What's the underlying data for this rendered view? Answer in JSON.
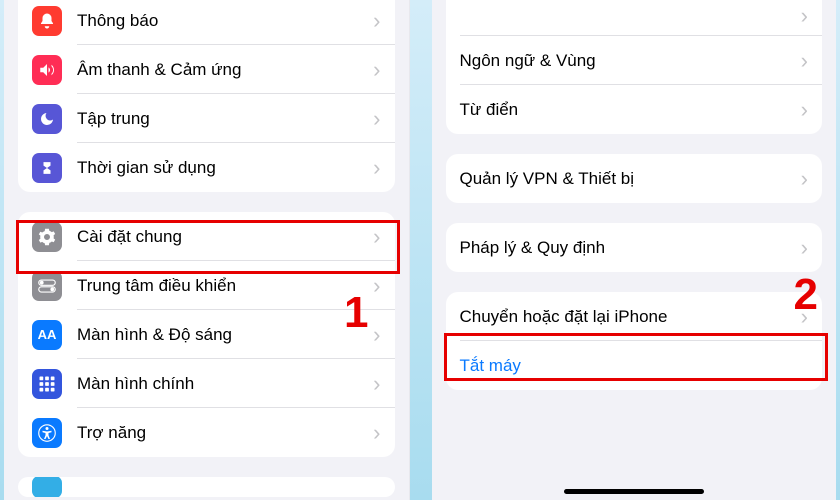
{
  "left_panel": {
    "group1": [
      {
        "label": "Thông báo",
        "icon": "bell",
        "icon_bg": "#ff3b30"
      },
      {
        "label": "Âm thanh & Cảm ứng",
        "icon": "sound",
        "icon_bg": "#ff2d55"
      },
      {
        "label": "Tập trung",
        "icon": "moon",
        "icon_bg": "#5756d6"
      },
      {
        "label": "Thời gian sử dụng",
        "icon": "hourglass",
        "icon_bg": "#5856d6"
      }
    ],
    "group2": [
      {
        "label": "Cài đặt chung",
        "icon": "gear",
        "icon_bg": "#8e8e93"
      },
      {
        "label": "Trung tâm điều khiển",
        "icon": "switches",
        "icon_bg": "#8e8e93"
      },
      {
        "label": "Màn hình & Độ sáng",
        "icon": "AA",
        "icon_bg": "#0a7aff"
      },
      {
        "label": "Màn hình chính",
        "icon": "grid",
        "icon_bg": "#3355dd"
      },
      {
        "label": "Trợ năng",
        "icon": "access",
        "icon_bg": "#0a7aff"
      }
    ]
  },
  "right_panel": {
    "group1": [
      {
        "label": "Ngôn ngữ & Vùng"
      },
      {
        "label": "Từ điển"
      }
    ],
    "group2": [
      {
        "label": "Quản lý VPN & Thiết bị"
      }
    ],
    "group3": [
      {
        "label": "Pháp lý & Quy định"
      }
    ],
    "group4": [
      {
        "label": "Chuyển hoặc đặt lại iPhone"
      },
      {
        "label": "Tắt máy",
        "is_link": true
      }
    ]
  },
  "annotations": {
    "left_step": "1",
    "right_step": "2"
  }
}
